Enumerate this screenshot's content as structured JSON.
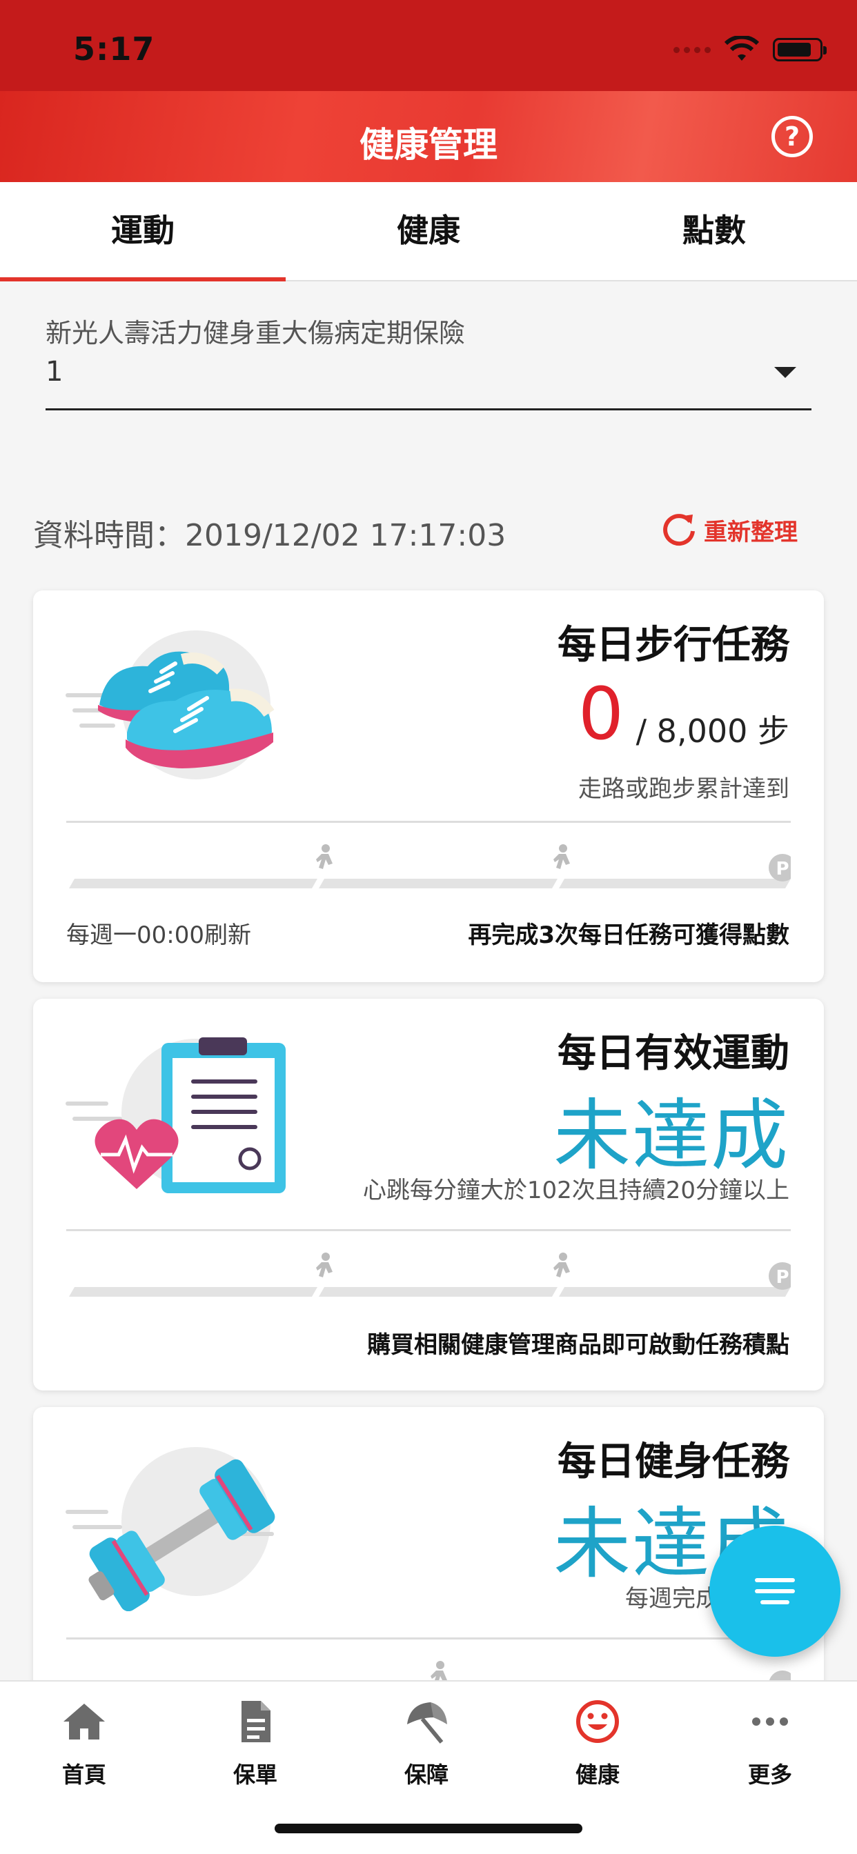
{
  "status_bar": {
    "time": "5:17"
  },
  "app_bar": {
    "title": "健康管理",
    "help_glyph": "?"
  },
  "tabs": [
    {
      "label": "運動",
      "active": true
    },
    {
      "label": "健康",
      "active": false
    },
    {
      "label": "點數",
      "active": false
    }
  ],
  "policy_select": {
    "label": "新光人壽活力健身重大傷病定期保險",
    "value": "1"
  },
  "data_time": "資料時間：2019/12/02 17:17:03",
  "refresh_label": "重新整理",
  "cards": [
    {
      "title": "每日步行任務",
      "current": "0",
      "goal": "/  8,000  步",
      "desc": "走路或跑步累計達到",
      "footer_left": "每週一00:00刷新",
      "footer_right": "再完成3次每日任務可獲得點數",
      "icon": "sneakers-icon"
    },
    {
      "title": "每日有效運動",
      "status": "未達成",
      "desc": "心跳每分鐘大於102次且持續20分鐘以上",
      "footer_right": "購買相關健康管理商品即可啟動任務積點",
      "icon": "heart-clipboard-icon"
    },
    {
      "title": "每日健身任務",
      "status": "未達成",
      "desc": "每週完成二次健",
      "icon": "dumbbell-icon"
    }
  ],
  "bottom_nav": [
    {
      "label": "首頁",
      "icon": "home-icon"
    },
    {
      "label": "保單",
      "icon": "document-icon"
    },
    {
      "label": "保障",
      "icon": "umbrella-icon"
    },
    {
      "label": "健康",
      "icon": "smile-icon",
      "active": true
    },
    {
      "label": "更多",
      "icon": "more-icon"
    }
  ],
  "colors": {
    "primary_red": "#e3342b",
    "accent_blue": "#1ea3c8",
    "fab_blue": "#1ac0ea"
  }
}
